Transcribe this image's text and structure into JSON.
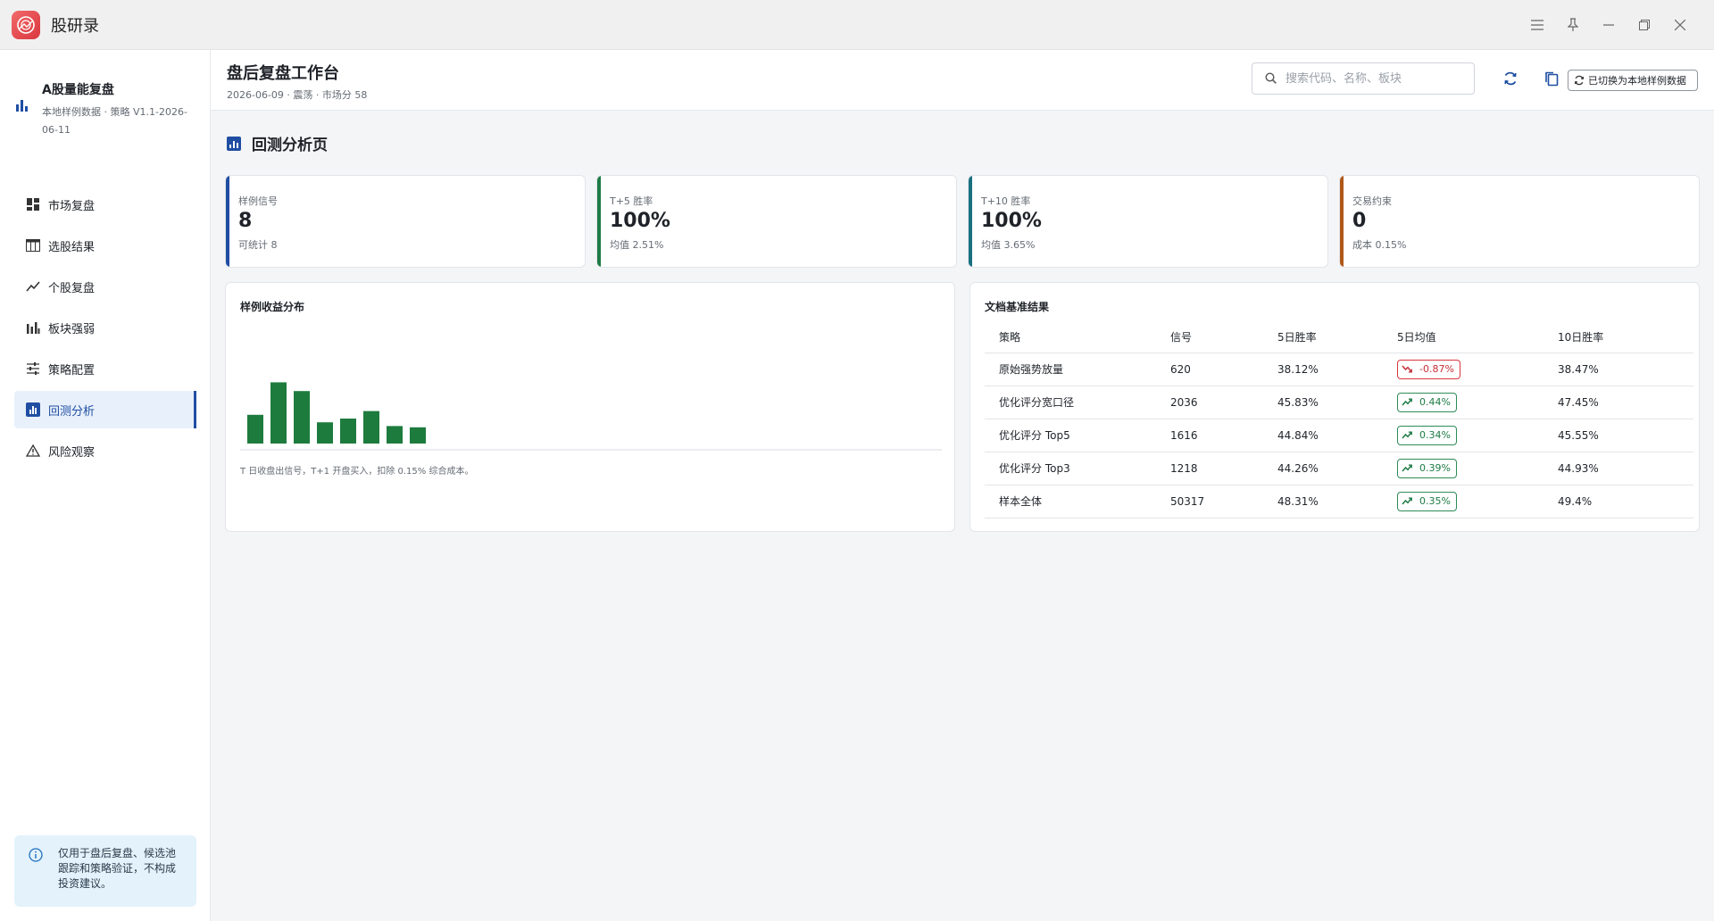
{
  "app": {
    "title": "股研录"
  },
  "brand": {
    "title": "A股量能复盘",
    "subtitle": "本地样例数据 · 策略 V1.1-2026-06-11"
  },
  "nav": [
    {
      "label": "市场复盘",
      "icon": "dashboard-icon",
      "active": false
    },
    {
      "label": "选股结果",
      "icon": "table-icon",
      "active": false
    },
    {
      "label": "个股复盘",
      "icon": "trend-icon",
      "active": false
    },
    {
      "label": "板块强弱",
      "icon": "bars-icon",
      "active": false
    },
    {
      "label": "策略配置",
      "icon": "sliders-icon",
      "active": false
    },
    {
      "label": "回测分析",
      "icon": "chart-icon",
      "active": true
    },
    {
      "label": "风险观察",
      "icon": "warning-icon",
      "active": false
    }
  ],
  "notice": {
    "text": "仅用于盘后复盘、候选池跟踪和策略验证，不构成投资建议。"
  },
  "header": {
    "title": "盘后复盘工作台",
    "meta": "2026-06-09 · 震荡 · 市场分 58",
    "search_placeholder": "搜索代码、名称、板块",
    "local_button": "已切换为本地样例数据"
  },
  "section": {
    "title": "回测分析页"
  },
  "cards": [
    {
      "label": "样例信号",
      "value": "8",
      "sub": "可统计 8",
      "color": "#1f4ea3"
    },
    {
      "label": "T+5 胜率",
      "value": "100%",
      "sub": "均值 2.51%",
      "color": "#1e7b45"
    },
    {
      "label": "T+10 胜率",
      "value": "100%",
      "sub": "均值 3.65%",
      "color": "#1a6f80"
    },
    {
      "label": "交易约束",
      "value": "0",
      "sub": "成本 0.15%",
      "color": "#b0581a"
    }
  ],
  "chart": {
    "title": "样例收益分布",
    "note": "T 日收盘出信号，T+1 开盘买入，扣除 0.15% 综合成本。"
  },
  "chart_data": {
    "type": "bar",
    "values": [
      2.3,
      4.9,
      4.2,
      1.7,
      2.0,
      2.6,
      1.4,
      1.3
    ],
    "ylim": [
      0,
      5
    ],
    "color": "#1e7b3e",
    "grid": false
  },
  "table": {
    "title": "文档基准结果",
    "columns": [
      "策略",
      "信号",
      "5日胜率",
      "5日均值",
      "10日胜率"
    ],
    "rows": [
      {
        "strategy": "原始强势放量",
        "signals": "620",
        "win5": "38.12%",
        "avg5": "-0.87%",
        "trend": "down",
        "win10": "38.47%"
      },
      {
        "strategy": "优化评分宽口径",
        "signals": "2036",
        "win5": "45.83%",
        "avg5": "0.44%",
        "trend": "up",
        "win10": "47.45%"
      },
      {
        "strategy": "优化评分 Top5",
        "signals": "1616",
        "win5": "44.84%",
        "avg5": "0.34%",
        "trend": "up",
        "win10": "45.55%"
      },
      {
        "strategy": "优化评分 Top3",
        "signals": "1218",
        "win5": "44.26%",
        "avg5": "0.39%",
        "trend": "up",
        "win10": "44.93%"
      },
      {
        "strategy": "样本全体",
        "signals": "50317",
        "win5": "48.31%",
        "avg5": "0.35%",
        "trend": "up",
        "win10": "49.4%"
      }
    ]
  }
}
